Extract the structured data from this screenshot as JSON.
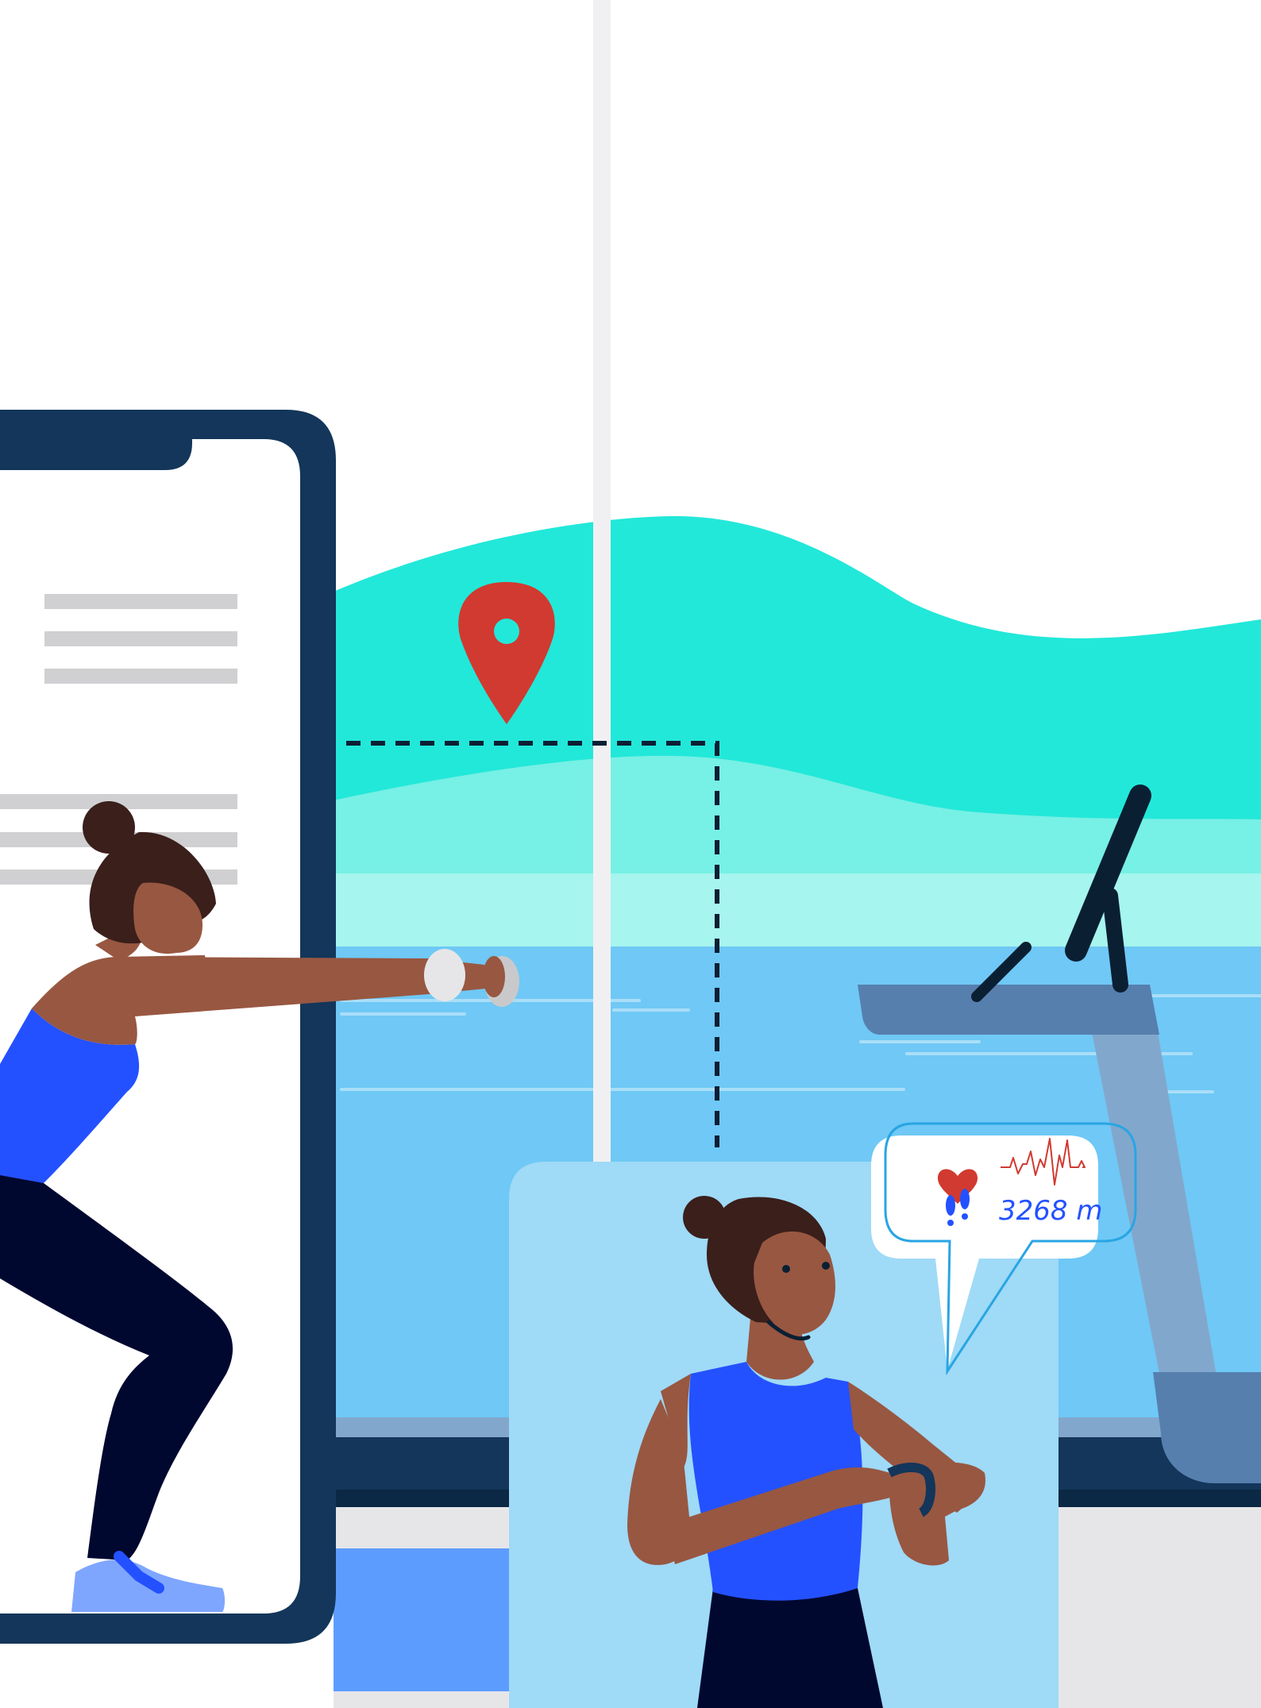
{
  "colors": {
    "background": "#ffffff",
    "water_top": "#22e8d9",
    "water_mid": "#77f0e5",
    "water_light": "#a6f5ee",
    "pool_blue": "#6fc8f5",
    "phone_frame": "#13365a",
    "screen_white": "#ffffff",
    "text_line": "#d0d0d2",
    "map_pin": "#d13a30",
    "pole": "#f0f0f2",
    "panel_light_blue": "#9fdaf7",
    "treadmill_dark": "#567fae",
    "treadmill_mid": "#82a7cc",
    "treadmill_handle": "#0b1f33",
    "skin": "#985741",
    "hair": "#3a1f1b",
    "top_blue": "#2451ff",
    "pants_navy": "#000830",
    "shoe_blue": "#7ea6ff",
    "floor_grey": "#e6e6e8",
    "floor_blue": "#5d9cff",
    "heart_red": "#d13a30",
    "footsteps_blue": "#2451ff",
    "bubble_outline": "#29a5e3"
  },
  "icons": {
    "map_pin": "map-pin-icon",
    "heart": "heart-icon",
    "heartbeat": "heartbeat-line-icon",
    "footsteps": "footsteps-icon"
  },
  "stats_bubble": {
    "distance": "3268 m"
  }
}
